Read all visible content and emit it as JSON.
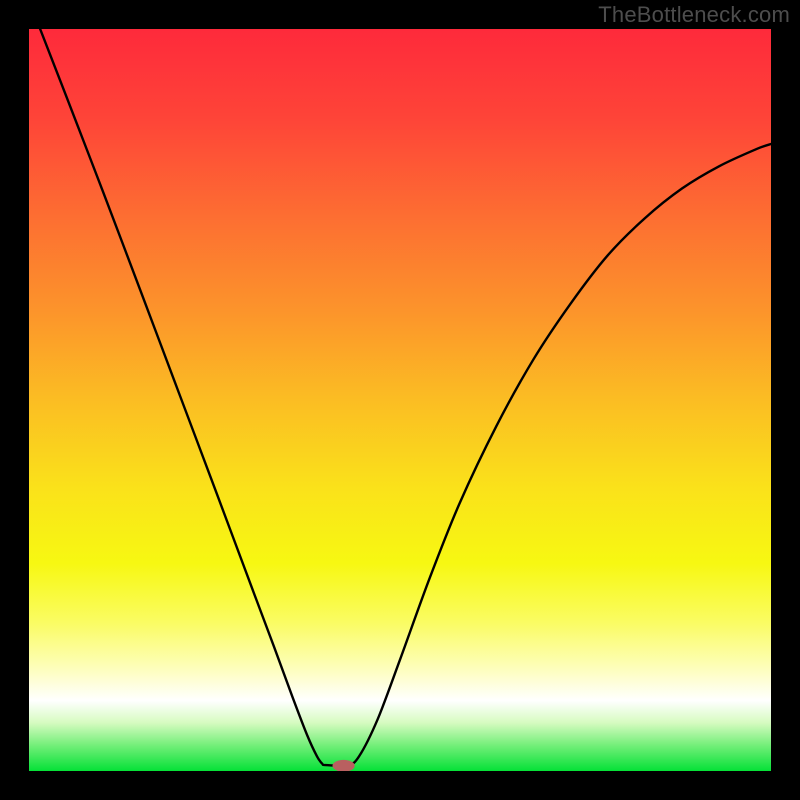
{
  "watermark": "TheBottleneck.com",
  "colors": {
    "frame": "#000000",
    "watermark": "#4d4d4d",
    "curve": "#000000",
    "pill": "#b96060",
    "gradient_stops": [
      {
        "offset": 0.0,
        "color": "#fe2a3b"
      },
      {
        "offset": 0.12,
        "color": "#fe4438"
      },
      {
        "offset": 0.25,
        "color": "#fd6d32"
      },
      {
        "offset": 0.38,
        "color": "#fc942b"
      },
      {
        "offset": 0.5,
        "color": "#fbbd23"
      },
      {
        "offset": 0.62,
        "color": "#fae21a"
      },
      {
        "offset": 0.72,
        "color": "#f7f812"
      },
      {
        "offset": 0.8,
        "color": "#fafc63"
      },
      {
        "offset": 0.86,
        "color": "#fdfeb9"
      },
      {
        "offset": 0.905,
        "color": "#ffffff"
      },
      {
        "offset": 0.935,
        "color": "#d6fbc0"
      },
      {
        "offset": 0.965,
        "color": "#75ef7a"
      },
      {
        "offset": 1.0,
        "color": "#05e137"
      }
    ]
  },
  "chart_data": {
    "type": "line",
    "title": "",
    "xlabel": "",
    "ylabel": "",
    "xlim": [
      0,
      1
    ],
    "ylim": [
      0,
      1
    ],
    "series": [
      {
        "name": "curve",
        "points": [
          {
            "x": 0.015,
            "y": 1.0
          },
          {
            "x": 0.05,
            "y": 0.91
          },
          {
            "x": 0.1,
            "y": 0.78
          },
          {
            "x": 0.15,
            "y": 0.648
          },
          {
            "x": 0.2,
            "y": 0.515
          },
          {
            "x": 0.25,
            "y": 0.382
          },
          {
            "x": 0.3,
            "y": 0.248
          },
          {
            "x": 0.33,
            "y": 0.168
          },
          {
            "x": 0.355,
            "y": 0.1
          },
          {
            "x": 0.375,
            "y": 0.048
          },
          {
            "x": 0.388,
            "y": 0.02
          },
          {
            "x": 0.395,
            "y": 0.01
          },
          {
            "x": 0.4,
            "y": 0.008
          },
          {
            "x": 0.43,
            "y": 0.008
          },
          {
            "x": 0.445,
            "y": 0.02
          },
          {
            "x": 0.47,
            "y": 0.07
          },
          {
            "x": 0.5,
            "y": 0.15
          },
          {
            "x": 0.54,
            "y": 0.26
          },
          {
            "x": 0.58,
            "y": 0.36
          },
          {
            "x": 0.63,
            "y": 0.465
          },
          {
            "x": 0.68,
            "y": 0.555
          },
          {
            "x": 0.73,
            "y": 0.63
          },
          {
            "x": 0.78,
            "y": 0.695
          },
          {
            "x": 0.83,
            "y": 0.745
          },
          {
            "x": 0.88,
            "y": 0.785
          },
          {
            "x": 0.93,
            "y": 0.815
          },
          {
            "x": 0.98,
            "y": 0.838
          },
          {
            "x": 1.0,
            "y": 0.845
          }
        ]
      }
    ],
    "marker": {
      "x": 0.424,
      "y": 0.007,
      "rx": 0.015,
      "ry": 0.008
    }
  }
}
